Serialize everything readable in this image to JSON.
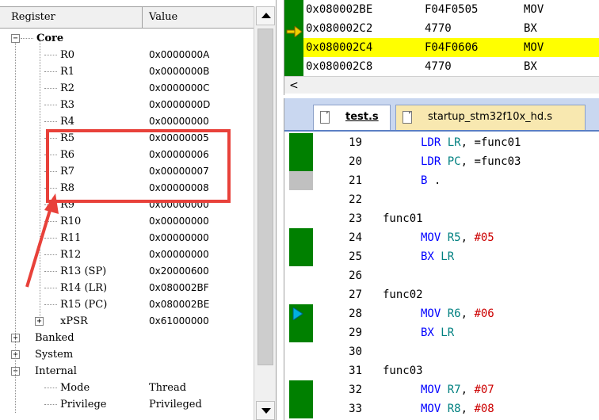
{
  "registers": {
    "header": {
      "col_register": "Register",
      "col_value": "Value"
    },
    "core_label": "Core",
    "core": [
      {
        "name": "R0",
        "value": "0x0000000A"
      },
      {
        "name": "R1",
        "value": "0x0000000B"
      },
      {
        "name": "R2",
        "value": "0x0000000C"
      },
      {
        "name": "R3",
        "value": "0x0000000D"
      },
      {
        "name": "R4",
        "value": "0x00000000"
      },
      {
        "name": "R5",
        "value": "0x00000005"
      },
      {
        "name": "R6",
        "value": "0x00000006"
      },
      {
        "name": "R7",
        "value": "0x00000007"
      },
      {
        "name": "R8",
        "value": "0x00000008"
      },
      {
        "name": "R9",
        "value": "0x00000000"
      },
      {
        "name": "R10",
        "value": "0x00000000"
      },
      {
        "name": "R11",
        "value": "0x00000000"
      },
      {
        "name": "R12",
        "value": "0x00000000"
      },
      {
        "name": "R13 (SP)",
        "value": "0x20000600"
      },
      {
        "name": "R14 (LR)",
        "value": "0x080002BF"
      },
      {
        "name": "R15 (PC)",
        "value": "0x080002BE"
      },
      {
        "name": "xPSR",
        "value": "0x61000000"
      }
    ],
    "groups": [
      "Banked",
      "System",
      "Internal"
    ],
    "internal": [
      {
        "name": "Mode",
        "value": "Thread"
      },
      {
        "name": "Privilege",
        "value": "Privileged"
      }
    ],
    "expand_plus": "+",
    "expand_minus": "−"
  },
  "disassembly": {
    "rows": [
      {
        "addr": "0x080002BE",
        "code": "F04F0505",
        "mnemonic": "MOV",
        "current": false
      },
      {
        "addr": "0x080002C2",
        "code": "4770",
        "mnemonic": "BX",
        "current": false
      },
      {
        "addr": "0x080002C4",
        "code": "F04F0606",
        "mnemonic": "MOV",
        "current": true
      },
      {
        "addr": "0x080002C8",
        "code": "4770",
        "mnemonic": "BX",
        "current": false
      }
    ],
    "scroll_left": "<"
  },
  "editor": {
    "tabs": [
      {
        "label": "test.s",
        "active": true
      },
      {
        "label": "startup_stm32f10x_hd.s",
        "active": false
      }
    ],
    "lines": [
      {
        "num": "19",
        "indent": true,
        "parts": [
          [
            "kw",
            "LDR"
          ],
          [
            "lb",
            " "
          ],
          [
            "rg",
            "LR"
          ],
          [
            "lb",
            ", =func01"
          ]
        ],
        "marker": "green"
      },
      {
        "num": "20",
        "indent": true,
        "parts": [
          [
            "kw",
            "LDR"
          ],
          [
            "lb",
            " "
          ],
          [
            "rg",
            "PC"
          ],
          [
            "lb",
            ", =func03"
          ]
        ],
        "marker": "green"
      },
      {
        "num": "21",
        "indent": true,
        "parts": [
          [
            "kw",
            "B"
          ],
          [
            "lb",
            " ."
          ]
        ],
        "marker": "gray"
      },
      {
        "num": "22",
        "indent": false,
        "parts": [],
        "marker": ""
      },
      {
        "num": "23",
        "indent": false,
        "parts": [
          [
            "lb",
            "func01"
          ]
        ],
        "marker": ""
      },
      {
        "num": "24",
        "indent": true,
        "parts": [
          [
            "kw",
            "MOV"
          ],
          [
            "lb",
            " "
          ],
          [
            "rg",
            "R5"
          ],
          [
            "lb",
            ", "
          ],
          [
            "nm",
            "#05"
          ]
        ],
        "marker": "green"
      },
      {
        "num": "25",
        "indent": true,
        "parts": [
          [
            "kw",
            "BX"
          ],
          [
            "lb",
            " "
          ],
          [
            "rg",
            "LR"
          ]
        ],
        "marker": "green"
      },
      {
        "num": "26",
        "indent": false,
        "parts": [],
        "marker": ""
      },
      {
        "num": "27",
        "indent": false,
        "parts": [
          [
            "lb",
            "func02"
          ]
        ],
        "marker": ""
      },
      {
        "num": "28",
        "indent": true,
        "parts": [
          [
            "kw",
            "MOV"
          ],
          [
            "lb",
            " "
          ],
          [
            "rg",
            "R6"
          ],
          [
            "lb",
            ", "
          ],
          [
            "nm",
            "#06"
          ]
        ],
        "marker": "green"
      },
      {
        "num": "29",
        "indent": true,
        "parts": [
          [
            "kw",
            "BX"
          ],
          [
            "lb",
            " "
          ],
          [
            "rg",
            "LR"
          ]
        ],
        "marker": "green"
      },
      {
        "num": "30",
        "indent": false,
        "parts": [],
        "marker": ""
      },
      {
        "num": "31",
        "indent": false,
        "parts": [
          [
            "lb",
            "func03"
          ]
        ],
        "marker": ""
      },
      {
        "num": "32",
        "indent": true,
        "parts": [
          [
            "kw",
            "MOV"
          ],
          [
            "lb",
            " "
          ],
          [
            "rg",
            "R7"
          ],
          [
            "lb",
            ", "
          ],
          [
            "nm",
            "#07"
          ]
        ],
        "marker": "green"
      },
      {
        "num": "33",
        "indent": true,
        "parts": [
          [
            "kw",
            "MOV"
          ],
          [
            "lb",
            " "
          ],
          [
            "rg",
            "R8"
          ],
          [
            "lb",
            ", "
          ],
          [
            "nm",
            "#08"
          ]
        ],
        "marker": "green"
      }
    ],
    "current_line": "28"
  },
  "colors": {
    "highlight_box": "#e8413a",
    "current_instruction": "#ffff00",
    "executed_marker": "#008000"
  }
}
